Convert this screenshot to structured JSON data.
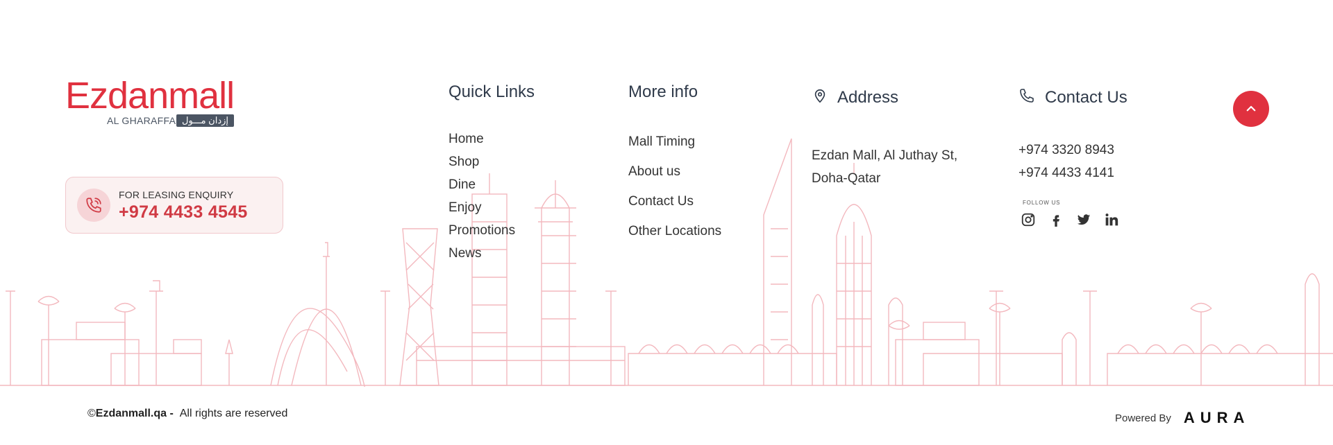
{
  "brand": {
    "logo_text": "Ezdanmall",
    "logo_subtitle": "AL GHARAFFA",
    "logo_arabic": "إزدان مـــول",
    "accent_color": "#e0313f"
  },
  "leasing": {
    "label": "FOR LEASING ENQUIRY",
    "phone": "+974 4433 4545",
    "icon": "phone-icon"
  },
  "quick_links": {
    "title": "Quick Links",
    "items": [
      "Home",
      "Shop",
      "Dine",
      "Enjoy",
      "Promotions",
      "News"
    ]
  },
  "more_info": {
    "title": "More info",
    "items": [
      "Mall Timing",
      "About us",
      "Contact Us",
      "Other Locations"
    ]
  },
  "address": {
    "title": "Address",
    "icon": "map-pin-icon",
    "line1": "Ezdan Mall, Al Juthay St,",
    "line2": "Doha-Qatar"
  },
  "contact": {
    "title": "Contact Us",
    "icon": "phone-icon",
    "phones": [
      "+974 3320 8943",
      "+974 4433 4141"
    ],
    "follow_label": "FOLLOW US",
    "social": [
      "instagram-icon",
      "facebook-icon",
      "twitter-icon",
      "linkedin-icon"
    ]
  },
  "scroll_top": {
    "icon": "chevron-up-icon"
  },
  "footer": {
    "copyright_symbol": "©",
    "site": "Ezdanmall.qa -",
    "rights": "All rights are reserved",
    "powered_by": "Powered By",
    "powered_brand": "AURA"
  }
}
